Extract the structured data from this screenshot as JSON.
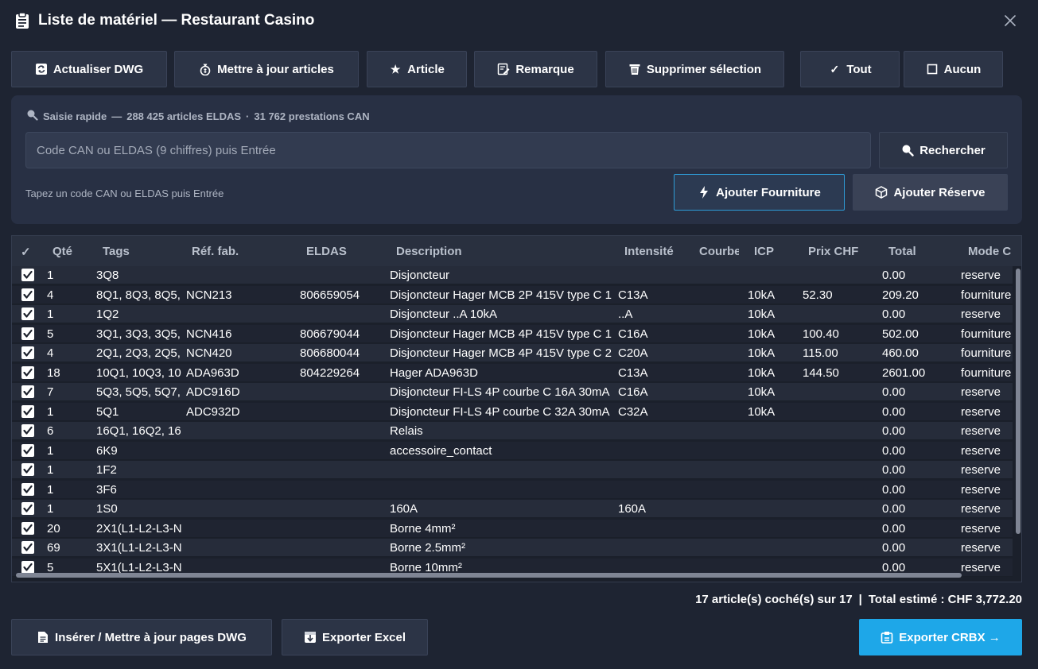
{
  "window": {
    "title": "Liste de matériel — Restaurant Casino",
    "close_icon": "close-icon"
  },
  "toolbar": {
    "refresh_dwg": "Actualiser DWG",
    "update_articles": "Mettre à jour articles",
    "article": "Article",
    "remark": "Remarque",
    "delete_selection": "Supprimer sélection",
    "select_all": "Tout",
    "select_none": "Aucun"
  },
  "quick": {
    "label": "Saisie rapide",
    "dash": "—",
    "eldas_count": "288 425 articles ELDAS",
    "dot": "·",
    "can_count": "31 762 prestations CAN",
    "placeholder": "Code CAN ou ELDAS (9 chiffres) puis Entrée",
    "search_button": "Rechercher",
    "hint": "Tapez un code CAN ou ELDAS puis Entrée",
    "add_supply": "Ajouter Fourniture",
    "add_reserve": "Ajouter Réserve"
  },
  "table": {
    "columns": {
      "check": "✓",
      "qty": "Qté",
      "tags": "Tags",
      "ref": "Réf. fab.",
      "eldas": "ELDAS",
      "description": "Description",
      "intensity": "Intensité",
      "curve": "Courbe",
      "icp": "ICP",
      "price": "Prix CHF",
      "total": "Total",
      "mode": "Mode C"
    },
    "rows": [
      {
        "qty": "1",
        "tags": "3Q8",
        "ref": "",
        "eldas": "",
        "description": "Disjoncteur",
        "intensity": "",
        "curve": "",
        "icp": "",
        "price": "",
        "total": "0.00",
        "mode": "reserve"
      },
      {
        "qty": "4",
        "tags": "8Q1, 8Q3, 8Q5,",
        "ref": "NCN213",
        "eldas": "806659054",
        "description": "Disjoncteur Hager MCB 2P 415V type C 1",
        "intensity": "C13A",
        "curve": "",
        "icp": "10kA",
        "price": "52.30",
        "total": "209.20",
        "mode": "fourniture"
      },
      {
        "qty": "1",
        "tags": "1Q2",
        "ref": "",
        "eldas": "",
        "description": "Disjoncteur ..A 10kA",
        "intensity": "..A",
        "curve": "",
        "icp": "10kA",
        "price": "",
        "total": "0.00",
        "mode": "reserve"
      },
      {
        "qty": "5",
        "tags": "3Q1, 3Q3, 3Q5,",
        "ref": "NCN416",
        "eldas": "806679044",
        "description": "Disjoncteur Hager MCB 4P 415V type C 1",
        "intensity": "C16A",
        "curve": "",
        "icp": "10kA",
        "price": "100.40",
        "total": "502.00",
        "mode": "fourniture"
      },
      {
        "qty": "4",
        "tags": "2Q1, 2Q3, 2Q5,",
        "ref": "NCN420",
        "eldas": "806680044",
        "description": "Disjoncteur Hager MCB 4P 415V type C 2",
        "intensity": "C20A",
        "curve": "",
        "icp": "10kA",
        "price": "115.00",
        "total": "460.00",
        "mode": "fourniture"
      },
      {
        "qty": "18",
        "tags": "10Q1, 10Q3, 10",
        "ref": "ADA963D",
        "eldas": "804229264",
        "description": "Hager ADA963D",
        "intensity": "C13A",
        "curve": "",
        "icp": "10kA",
        "price": "144.50",
        "total": "2601.00",
        "mode": "fourniture"
      },
      {
        "qty": "7",
        "tags": "5Q3, 5Q5, 5Q7,",
        "ref": "ADC916D",
        "eldas": "",
        "description": "Disjoncteur FI-LS 4P courbe C 16A 30mA",
        "intensity": "C16A",
        "curve": "",
        "icp": "10kA",
        "price": "",
        "total": "0.00",
        "mode": "reserve"
      },
      {
        "qty": "1",
        "tags": "5Q1",
        "ref": "ADC932D",
        "eldas": "",
        "description": "Disjoncteur FI-LS 4P courbe C 32A 30mA",
        "intensity": "C32A",
        "curve": "",
        "icp": "10kA",
        "price": "",
        "total": "0.00",
        "mode": "reserve"
      },
      {
        "qty": "6",
        "tags": "16Q1, 16Q2, 16",
        "ref": "",
        "eldas": "",
        "description": "Relais",
        "intensity": "",
        "curve": "",
        "icp": "",
        "price": "",
        "total": "0.00",
        "mode": "reserve"
      },
      {
        "qty": "1",
        "tags": "6K9",
        "ref": "",
        "eldas": "",
        "description": "accessoire_contact",
        "intensity": "",
        "curve": "",
        "icp": "",
        "price": "",
        "total": "0.00",
        "mode": "reserve"
      },
      {
        "qty": "1",
        "tags": "1F2",
        "ref": "",
        "eldas": "",
        "description": "",
        "intensity": "",
        "curve": "",
        "icp": "",
        "price": "",
        "total": "0.00",
        "mode": "reserve"
      },
      {
        "qty": "1",
        "tags": "3F6",
        "ref": "",
        "eldas": "",
        "description": "",
        "intensity": "",
        "curve": "",
        "icp": "",
        "price": "",
        "total": "0.00",
        "mode": "reserve"
      },
      {
        "qty": "1",
        "tags": "1S0",
        "ref": "",
        "eldas": "",
        "description": "160A",
        "intensity": "160A",
        "curve": "",
        "icp": "",
        "price": "",
        "total": "0.00",
        "mode": "reserve"
      },
      {
        "qty": "20",
        "tags": "2X1(L1-L2-L3-N",
        "ref": "",
        "eldas": "",
        "description": "Borne 4mm²",
        "intensity": "",
        "curve": "",
        "icp": "",
        "price": "",
        "total": "0.00",
        "mode": "reserve"
      },
      {
        "qty": "69",
        "tags": "3X1(L1-L2-L3-N",
        "ref": "",
        "eldas": "",
        "description": "Borne 2.5mm²",
        "intensity": "",
        "curve": "",
        "icp": "",
        "price": "",
        "total": "0.00",
        "mode": "reserve"
      },
      {
        "qty": "5",
        "tags": "5X1(L1-L2-L3-N",
        "ref": "",
        "eldas": "",
        "description": "Borne 10mm²",
        "intensity": "",
        "curve": "",
        "icp": "",
        "price": "",
        "total": "0.00",
        "mode": "reserve"
      }
    ]
  },
  "summary": {
    "checked": "17 article(s) coché(s) sur 17",
    "separator": "|",
    "total": "Total estimé : CHF 3,772.20"
  },
  "footer": {
    "insert_pages": "Insérer / Mettre à jour pages DWG",
    "export_excel": "Exporter Excel",
    "export_crbx": "Exporter CRBX →"
  },
  "colors": {
    "background": "#1e2432",
    "panel": "#283044",
    "button": "#2c3446",
    "accent": "#1ea7e8",
    "accent_border": "#2e9bd6"
  }
}
